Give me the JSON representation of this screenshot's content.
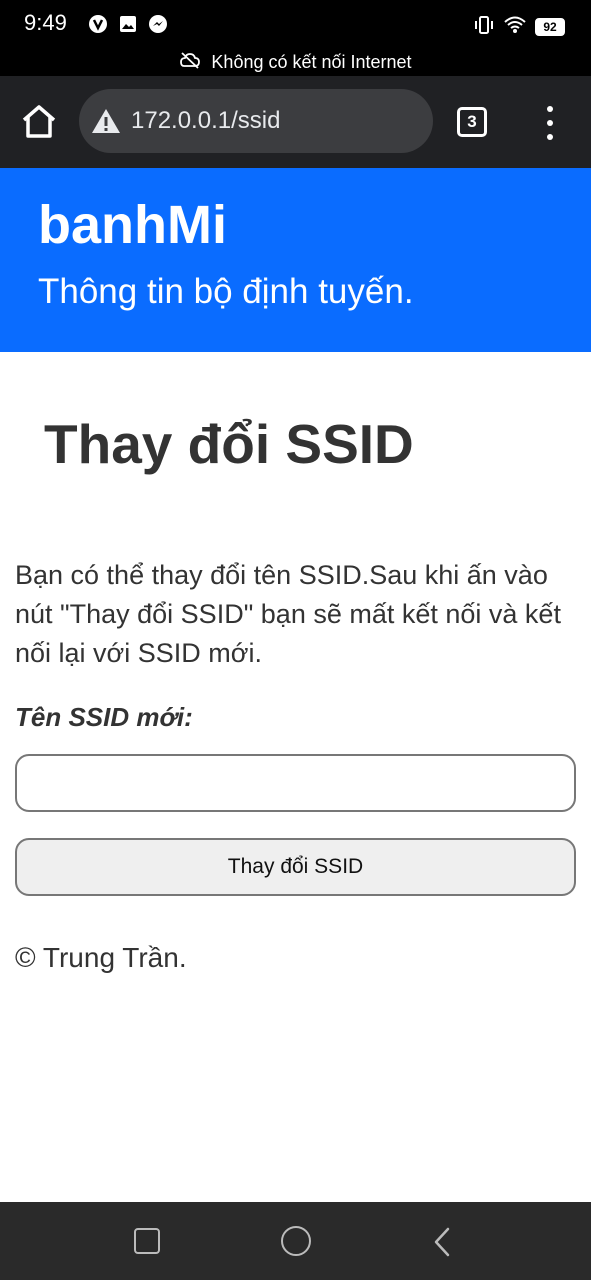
{
  "status_bar": {
    "time": "9:49",
    "battery": "92",
    "left_icons": [
      "notification-app-icon",
      "image-icon",
      "messenger-icon"
    ],
    "right_icons": [
      "vibrate-icon",
      "wifi-icon",
      "battery-icon"
    ]
  },
  "offline_banner": {
    "text": "Không có kết nối Internet",
    "icon": "cloud-off-icon"
  },
  "browser": {
    "url": "172.0.0.1/ssid",
    "tab_count": "3"
  },
  "header": {
    "brand": "banhMi",
    "tagline": "Thông tin bộ định tuyến."
  },
  "main": {
    "title": "Thay đổi SSID",
    "intro": "Bạn có thể thay đổi tên SSID.Sau khi ấn vào nút \"Thay đổi SSID\" bạn sẽ mất kết nối và kết nối lại với SSID mới.",
    "field_label": "Tên SSID mới:",
    "input_value": "",
    "submit_label": "Thay đổi SSID"
  },
  "footer": {
    "text": "© Trung Trần."
  },
  "colors": {
    "header_bg": "#0a6cff",
    "toolbar_bg": "#202124",
    "url_box_bg": "#3c3d40",
    "button_bg": "#efefef"
  }
}
